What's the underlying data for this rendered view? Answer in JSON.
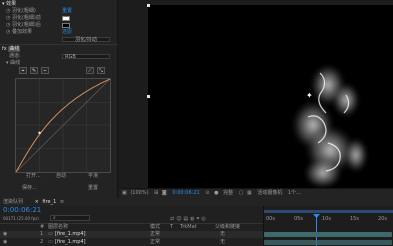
{
  "effects_panel": {
    "header_title": "效果",
    "rows": [
      {
        "label": "羽化(粗細)",
        "value": "重置"
      },
      {
        "label": "羽化(粗細)前",
        "value": ""
      },
      {
        "label": "羽化(粗細)后",
        "value": ""
      },
      {
        "label": "叠加效果",
        "value": "还原"
      }
    ],
    "button_label": "羽化/抖动",
    "section_title": "曲线",
    "channel_label": "通道:",
    "channel_value": "RGB",
    "curve_label": "曲线",
    "bottom_labels": {
      "left": "打开...",
      "middle": "自动",
      "right": "平滑"
    },
    "bottom_labels_2": {
      "left": "保存...",
      "right": "重置"
    }
  },
  "viewer": {
    "zoom": "(100%)",
    "timecode": "0:00:06:21",
    "resolution": "完整",
    "camera": "活动摄像机",
    "views": "1个..."
  },
  "timeline": {
    "tab_label": "渲染队列",
    "comp_tab": "fire_1",
    "timecode": "0:00:06:21",
    "frame_info": "00171 (25.00 fps)",
    "columns": [
      "#",
      "图层名称",
      "模式",
      "T",
      "TrkMat",
      "父级和链接"
    ],
    "layers": [
      {
        "num": "1",
        "name": "[fire_1.mp4]",
        "mode": "正常",
        "parent": "无"
      },
      {
        "num": "2",
        "name": "[fire_1.mp4]",
        "mode": "正常",
        "parent": "无"
      }
    ],
    "ruler_ticks": [
      "00s",
      "05s",
      "10s",
      "15s",
      "20s"
    ]
  },
  "colors": {
    "accent": "#2d8ceb",
    "curve": "#d9915a",
    "layer_bar": "#3e6a6e"
  }
}
